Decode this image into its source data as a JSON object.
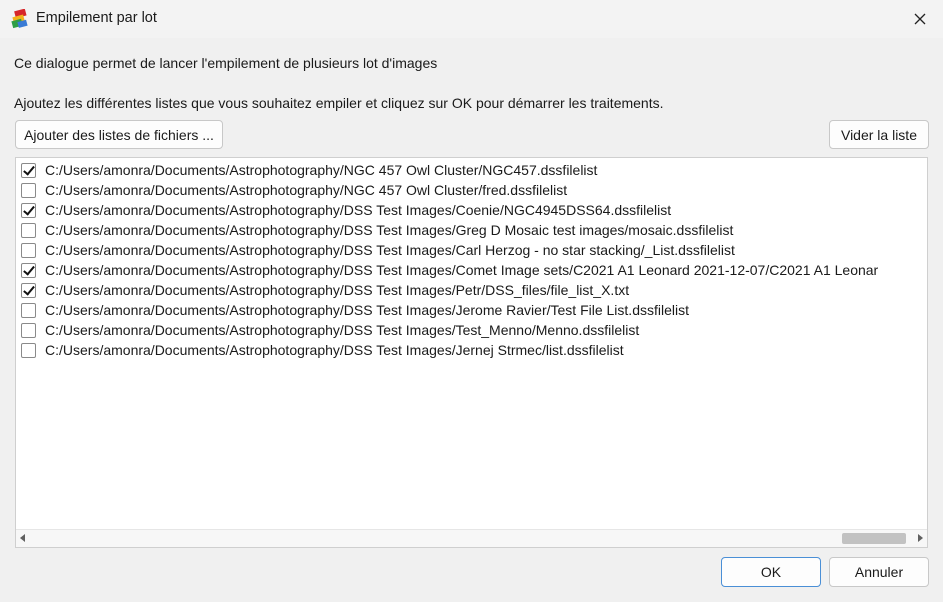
{
  "window": {
    "title": "Empilement par lot",
    "close_icon": "close-icon",
    "app_icon": "dss-app-icon"
  },
  "intro_text": "Ce dialogue permet de lancer l'empilement de plusieurs lot d'images",
  "instructions_text": "Ajoutez les différentes listes que vous souhaitez empiler et cliquez sur OK pour démarrer les traitements.",
  "buttons": {
    "add_lists": "Ajouter des listes de fichiers ...",
    "clear_list": "Vider la liste",
    "ok": "OK",
    "cancel": "Annuler"
  },
  "file_list": [
    {
      "checked": true,
      "path": "C:/Users/amonra/Documents/Astrophotography/NGC 457 Owl Cluster/NGC457.dssfilelist"
    },
    {
      "checked": false,
      "path": "C:/Users/amonra/Documents/Astrophotography/NGC 457 Owl Cluster/fred.dssfilelist"
    },
    {
      "checked": true,
      "path": "C:/Users/amonra/Documents/Astrophotography/DSS Test Images/Coenie/NGC4945DSS64.dssfilelist"
    },
    {
      "checked": false,
      "path": "C:/Users/amonra/Documents/Astrophotography/DSS Test Images/Greg D Mosaic test images/mosaic.dssfilelist"
    },
    {
      "checked": false,
      "path": "C:/Users/amonra/Documents/Astrophotography/DSS Test Images/Carl Herzog - no star stacking/_List.dssfilelist"
    },
    {
      "checked": true,
      "path": "C:/Users/amonra/Documents/Astrophotography/DSS Test Images/Comet Image sets/C2021 A1 Leonard 2021-12-07/C2021 A1 Leonar"
    },
    {
      "checked": true,
      "path": "C:/Users/amonra/Documents/Astrophotography/DSS Test Images/Petr/DSS_files/file_list_X.txt"
    },
    {
      "checked": false,
      "path": "C:/Users/amonra/Documents/Astrophotography/DSS Test Images/Jerome Ravier/Test File List.dssfilelist"
    },
    {
      "checked": false,
      "path": "C:/Users/amonra/Documents/Astrophotography/DSS Test Images/Test_Menno/Menno.dssfilelist"
    },
    {
      "checked": false,
      "path": "C:/Users/amonra/Documents/Astrophotography/DSS Test Images/Jernej Strmec/list.dssfilelist"
    }
  ],
  "scrollbar": {
    "left_arrow_icon": "scroll-left-arrow-icon",
    "right_arrow_icon": "scroll-right-arrow-icon",
    "thumb_position": 0.93,
    "thumb_fraction": 0.07
  },
  "colors": {
    "window_bg": "#f0f0f0",
    "list_bg": "#ffffff",
    "default_button_border": "#4a8fd6"
  }
}
